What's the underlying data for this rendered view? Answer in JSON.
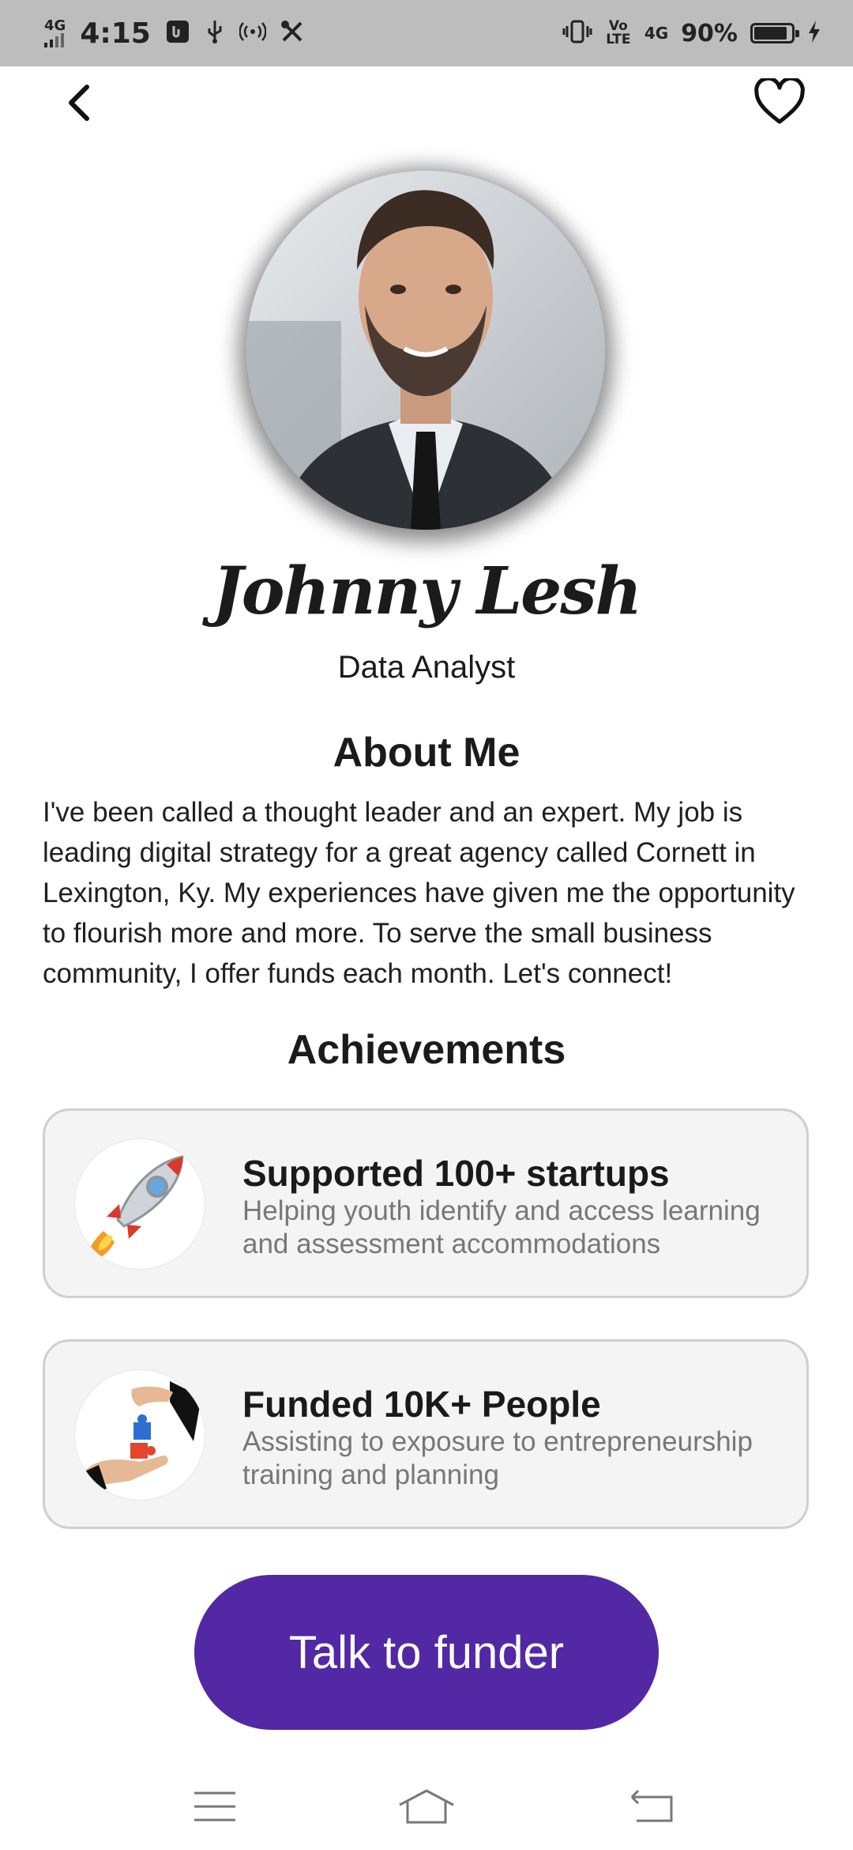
{
  "status_bar": {
    "network": "4G",
    "time": "4:15",
    "volte": "Vo LTE",
    "network2": "4G",
    "battery_percent": "90%",
    "battery_level": 0.9,
    "icons": [
      "signal-icon",
      "usb-debug-icon",
      "usb-icon",
      "hotspot-icon",
      "tools-icon",
      "vibrate-icon",
      "charging-icon"
    ]
  },
  "header": {
    "back_icon": "chevron-left-icon",
    "favorite_icon": "heart-outline-icon"
  },
  "profile": {
    "name": "Johnny Lesh",
    "role": "Data Analyst"
  },
  "about": {
    "title": "About Me",
    "text": "I've been called a thought leader and an expert. My job is leading digital strategy for a great agency called Cornett in Lexington, Ky. My experiences have given me the opportunity to flourish more and more. To serve the small business community, I offer funds each month. Let's connect!"
  },
  "achievements": {
    "title": "Achievements",
    "items": [
      {
        "icon": "rocket-icon",
        "title": "Supported 100+ startups",
        "description": "Helping youth identify and access learning and assessment accommodations"
      },
      {
        "icon": "puzzle-hands-icon",
        "title": "Funded 10K+ People",
        "description": "Assisting to exposure to entrepreneurship training and planning"
      }
    ]
  },
  "cta": {
    "label": "Talk to funder"
  },
  "colors": {
    "primary": "#5228a5",
    "card_bg": "#f4f4f4",
    "status_bar": "#bdbdbd"
  },
  "nav_bar": {
    "icons": [
      "menu-icon",
      "home-icon",
      "back-icon"
    ]
  }
}
